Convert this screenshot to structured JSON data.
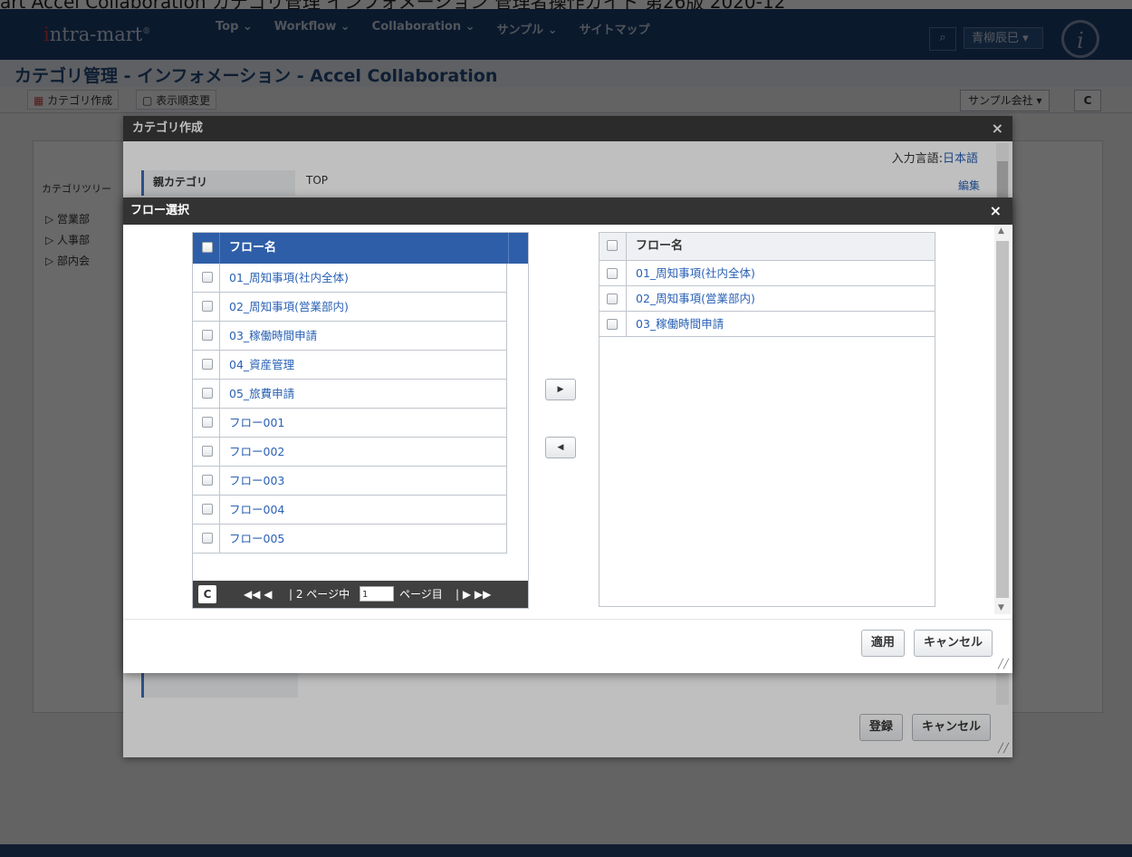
{
  "page_caption": "art Accel Collaboration カテゴリ管理 インフォメーション 管理者操作ガイド 第26版 2020-12",
  "navbar": {
    "logo_prefix": "i",
    "logo_text": "ntra-mart",
    "menu": [
      "Top ⌄",
      "Workflow ⌄",
      "Collaboration ⌄",
      "サンプル ⌄",
      "サイトマップ"
    ],
    "search_icon": "search-icon",
    "user_label": "青柳辰巳 ▾",
    "badge": "i"
  },
  "app_title": "カテゴリ管理 - インフォメーション - Accel Collaboration",
  "toolbar": {
    "create_label": "カテゴリ作成",
    "reorder_label": "表示順変更",
    "company_select": "サンプル会社 ▾",
    "refresh_icon": "refresh-icon"
  },
  "background": {
    "tree_header": "カテゴリツリー",
    "tree_items": [
      "▷ 営業部",
      "▷ 人事部",
      "▷ 部内会"
    ]
  },
  "category_dialog": {
    "title": "カテゴリ作成",
    "close": "×",
    "lang_label": "入力言語:",
    "lang_value": "日本語",
    "parent_label": "親カテゴリ",
    "parent_value": "TOP",
    "edit_link": "編集",
    "register_button": "登録",
    "cancel_button": "キャンセル"
  },
  "flow_dialog": {
    "title": "フロー選択",
    "close": "×",
    "left": {
      "header": "フロー名",
      "rows": [
        "01_周知事項(社内全体)",
        "02_周知事項(営業部内)",
        "03_稼働時間申請",
        "04_資産管理",
        "05_旅費申請",
        "フロー001",
        "フロー002",
        "フロー003",
        "フロー004",
        "フロー005"
      ],
      "pager": {
        "first_prev": "◀◀ ◀",
        "pages_text": "2 ページ中",
        "current_page": "1",
        "page_suffix": "ページ目",
        "next_last": "▶ ▶▶"
      }
    },
    "move_right": "▶",
    "move_left": "◀",
    "right": {
      "header": "フロー名",
      "rows": [
        "01_周知事項(社内全体)",
        "02_周知事項(営業部内)",
        "03_稼働時間申請"
      ]
    },
    "apply_button": "適用",
    "cancel_button": "キャンセル"
  }
}
